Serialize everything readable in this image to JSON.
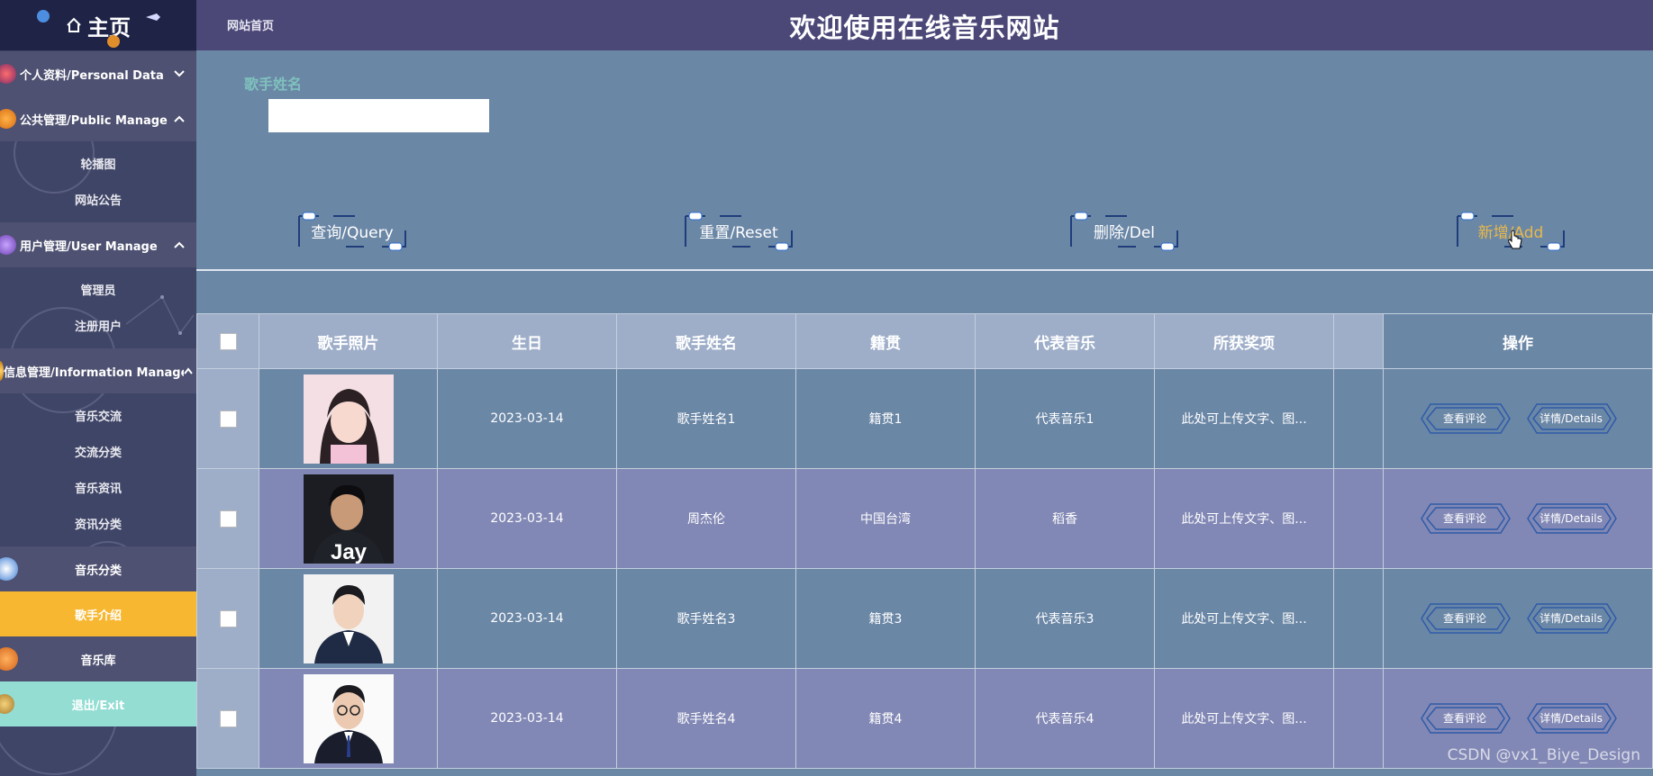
{
  "colors": {
    "sidebar_bg": "#3f4566",
    "header_bg": "#4b4878",
    "content_bg": "#6b87a6",
    "active_item": "#f7b731",
    "exit_item": "#93ddd3",
    "search_label": "#7fc1bd",
    "add_button_text": "#e8b84a"
  },
  "sidebar": {
    "logo": "主页",
    "groups": [
      {
        "label": "个人资料/Personal Data",
        "expanded": false,
        "items": []
      },
      {
        "label": "公共管理/Public Manage",
        "expanded": true,
        "items": [
          "轮播图",
          "网站公告"
        ]
      },
      {
        "label": "用户管理/User Manage",
        "expanded": true,
        "items": [
          "管理员",
          "注册用户"
        ]
      },
      {
        "label": "信息管理/Information Manage",
        "expanded": true,
        "items": [
          "音乐交流",
          "交流分类",
          "音乐资讯",
          "资讯分类"
        ]
      }
    ],
    "singles": [
      {
        "label": "音乐分类",
        "active": false
      },
      {
        "label": "歌手介绍",
        "active": true
      },
      {
        "label": "音乐库",
        "active": false
      },
      {
        "label": "退出/Exit",
        "active": false
      }
    ]
  },
  "header": {
    "breadcrumb": "网站首页",
    "title": "欢迎使用在线音乐网站"
  },
  "search": {
    "label": "歌手姓名",
    "value": "",
    "placeholder": ""
  },
  "actions": [
    "查询/Query",
    "重置/Reset",
    "删除/Del",
    "新增/Add"
  ],
  "table": {
    "columns": [
      "",
      "歌手照片",
      "生日",
      "歌手姓名",
      "籍贯",
      "代表音乐",
      "所获奖项",
      "",
      "操作"
    ],
    "rows": [
      {
        "birthday": "2023-03-14",
        "name": "歌手姓名1",
        "origin": "籍贯1",
        "music": "代表音乐1",
        "awards": "此处可上传文字、图...",
        "photo": "singer-photo-female"
      },
      {
        "birthday": "2023-03-14",
        "name": "周杰伦",
        "origin": "中国台湾",
        "music": "稻香",
        "awards": "此处可上传文字、图...",
        "photo": "singer-photo-jay"
      },
      {
        "birthday": "2023-03-14",
        "name": "歌手姓名3",
        "origin": "籍贯3",
        "music": "代表音乐3",
        "awards": "此处可上传文字、图...",
        "photo": "singer-photo-male-suit"
      },
      {
        "birthday": "2023-03-14",
        "name": "歌手姓名4",
        "origin": "籍贯4",
        "music": "代表音乐4",
        "awards": "此处可上传文字、图...",
        "photo": "singer-photo-male-glasses"
      }
    ],
    "row_actions": [
      "查看评论",
      "详情/Details"
    ],
    "photo_overlay_text": "Jay"
  },
  "watermark": "CSDN @vx1_Biye_Design"
}
